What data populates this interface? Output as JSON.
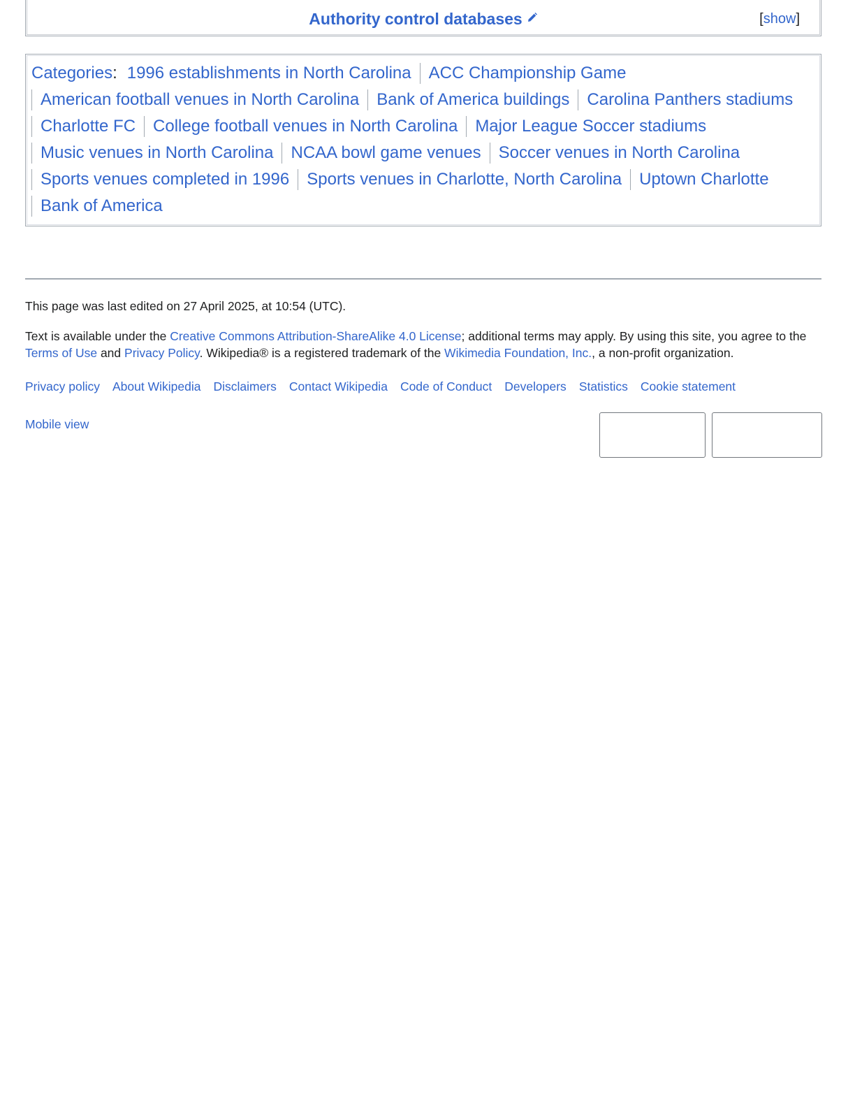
{
  "navbox": {
    "title": "Authority control databases",
    "edit_icon": "pencil-icon",
    "toggle_open": "[",
    "toggle_label": "show",
    "toggle_close": "]"
  },
  "categories": {
    "heading": "Categories",
    "colon": ":",
    "lines": [
      [
        "1996 establishments in North Carolina",
        "ACC Championship Game"
      ],
      [
        "American football venues in North Carolina",
        "Bank of America buildings",
        "Carolina Panthers stadiums"
      ],
      [
        "Charlotte FC",
        "College football venues in North Carolina",
        "Major League Soccer stadiums"
      ],
      [
        "Music venues in North Carolina",
        "NCAA bowl game venues",
        "Soccer venues in North Carolina"
      ],
      [
        "Sports venues completed in 1996",
        "Sports venues in Charlotte, North Carolina",
        "Uptown Charlotte"
      ],
      [
        "Bank of America"
      ]
    ]
  },
  "footer": {
    "last_edited": "This page was last edited on 27 April 2025, at 10:54 (UTC).",
    "license": {
      "t1": "Text is available under the ",
      "cc_link": "Creative Commons Attribution-ShareAlike 4.0 License",
      "t2": "; additional terms may apply. By using this site, you agree to the ",
      "terms_link": "Terms of Use",
      "t3": " and ",
      "privacy_link": "Privacy Policy",
      "t4": ". Wikipedia® is a registered trademark of the ",
      "wmf_link": "Wikimedia Foundation, Inc.",
      "t5": ", a non-profit organization."
    },
    "places": [
      "Privacy policy",
      "About Wikipedia",
      "Disclaimers",
      "Contact Wikipedia",
      "Code of Conduct",
      "Developers",
      "Statistics",
      "Cookie statement"
    ],
    "mobile_view": "Mobile view",
    "icons": [
      "wikimedia-foundation-badge",
      "powered-by-mediawiki-badge"
    ]
  },
  "colors": {
    "link": "#3366cc",
    "text": "#202122",
    "border": "#a2a9b1"
  }
}
